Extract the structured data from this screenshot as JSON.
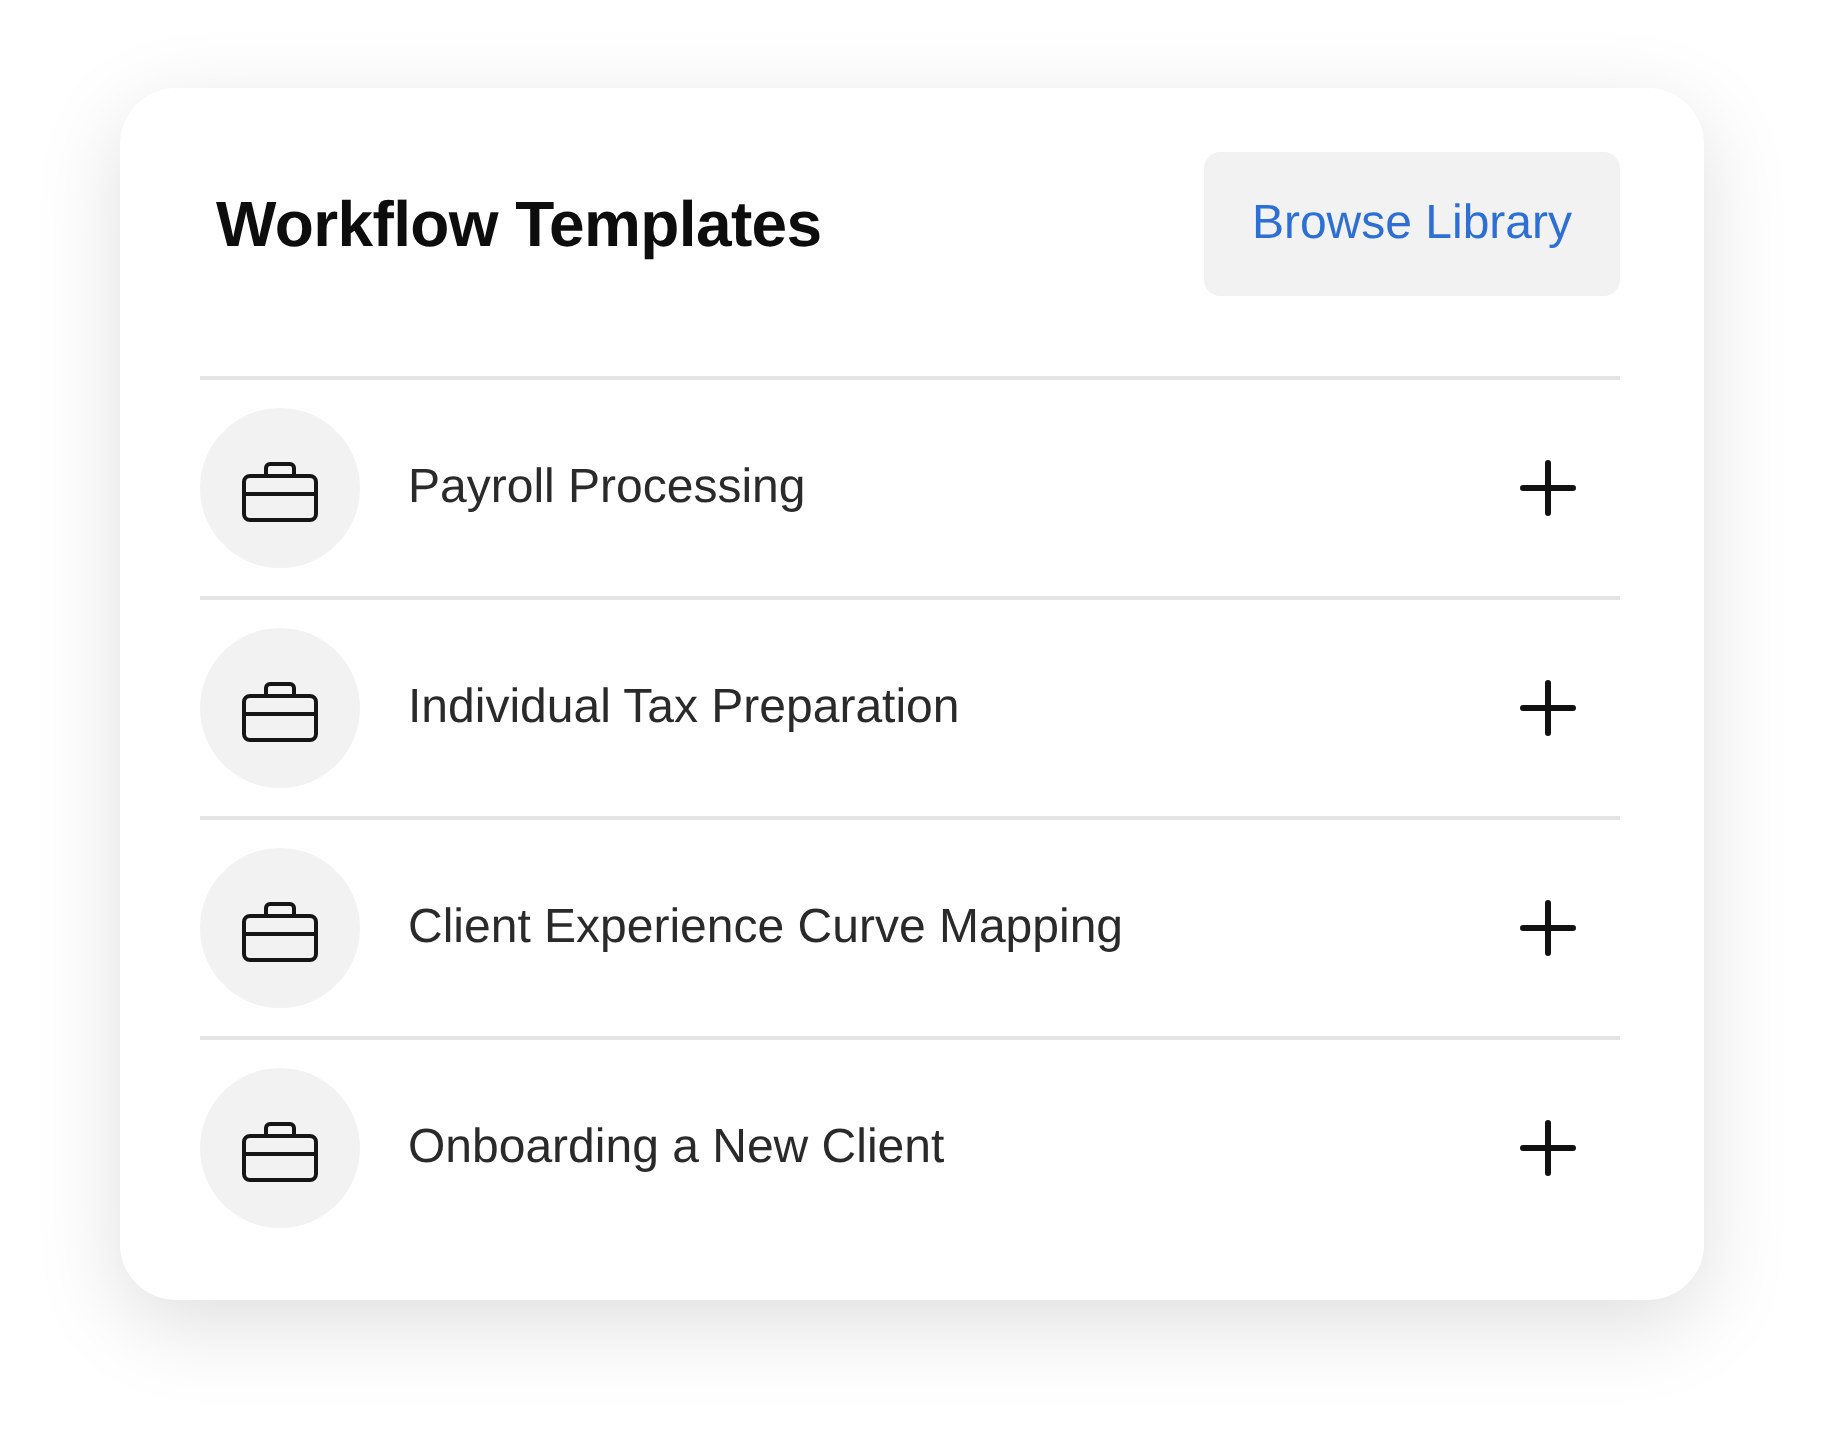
{
  "card": {
    "title": "Workflow Templates",
    "browse_button": "Browse Library"
  },
  "templates": [
    {
      "name": "Payroll Processing"
    },
    {
      "name": "Individual Tax Preparation"
    },
    {
      "name": "Client Experience Curve Mapping"
    },
    {
      "name": "Onboarding a New Client"
    }
  ]
}
